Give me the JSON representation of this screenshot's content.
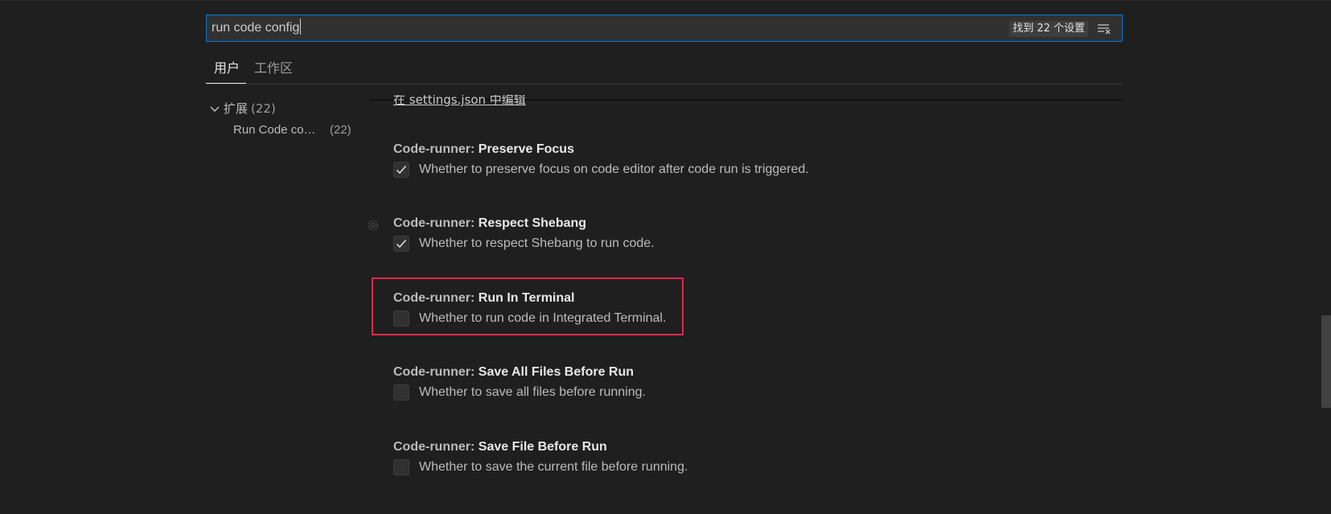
{
  "search": {
    "value": "run code config",
    "result_count": "找到 22 个设置",
    "clear_filter_icon": "clear-filter-icon"
  },
  "tabs": [
    {
      "label": "用户",
      "active": true
    },
    {
      "label": "工作区",
      "active": false
    }
  ],
  "toc": {
    "group_label": "扩展",
    "group_count": "(22)",
    "item_label": "Run Code co…",
    "item_count": "(22)"
  },
  "edit_link": "在 settings.json 中编辑",
  "settings": [
    {
      "category": "Code-runner: ",
      "name": "Preserve Focus",
      "description": "Whether to preserve focus on code editor after code run is triggered.",
      "checked": true
    },
    {
      "category": "Code-runner: ",
      "name": "Respect Shebang",
      "description": "Whether to respect Shebang to run code.",
      "checked": true
    },
    {
      "category": "Code-runner: ",
      "name": "Run In Terminal",
      "description": "Whether to run code in Integrated Terminal.",
      "checked": false
    },
    {
      "category": "Code-runner: ",
      "name": "Save All Files Before Run",
      "description": "Whether to save all files before running.",
      "checked": false
    },
    {
      "category": "Code-runner: ",
      "name": "Save File Before Run",
      "description": "Whether to save the current file before running.",
      "checked": false
    }
  ],
  "colors": {
    "background": "#1f1f1f",
    "focus_border": "#0078d4",
    "highlight_box": "#e0284a"
  }
}
